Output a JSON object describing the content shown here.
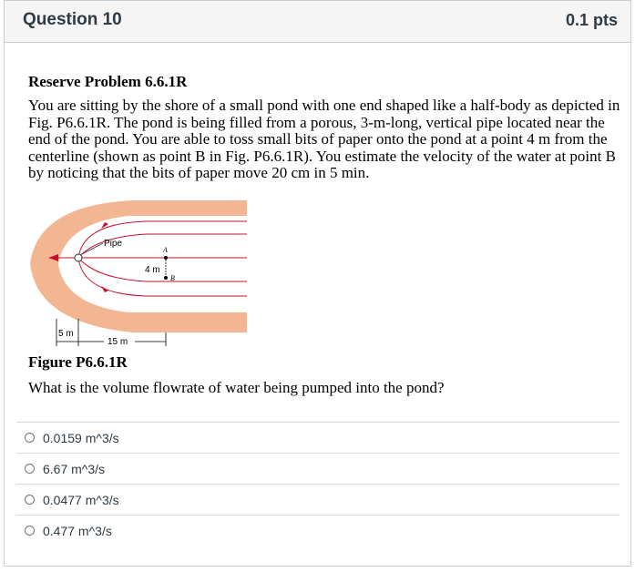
{
  "question": {
    "title": "Question 10",
    "points": "0.1 pts"
  },
  "problem": {
    "title": "Reserve Problem 6.6.1R",
    "text": "You are sitting by the shore of a small pond with one end shaped like a half-body as depicted in Fig. P6.6.1R. The pond is being filled from a porous, 3-m-long, vertical pipe located near the end of the pond. You are able to toss small bits of paper onto the pond at a point 4 m from the centerline (shown as point B in Fig. P6.6.1R). You estimate the velocity of the water at point B by noticing that the bits of paper move 20 cm in 5 min.",
    "figure_caption": "Figure P6.6.1R",
    "prompt": "What is the volume flowrate of water being pumped into the pond?"
  },
  "figure": {
    "pipe_label": "Pipe",
    "point_a": "A",
    "point_b": "B",
    "dist_4m": "4 m",
    "dist_5m": "5 m",
    "dist_15m": "15 m",
    "shore_color": "#f2b792",
    "line_color": "#c8102e"
  },
  "answers": [
    {
      "label": "0.0159 m^3/s"
    },
    {
      "label": "6.67 m^3/s"
    },
    {
      "label": "0.0477 m^3/s"
    },
    {
      "label": "0.477 m^3/s"
    }
  ]
}
